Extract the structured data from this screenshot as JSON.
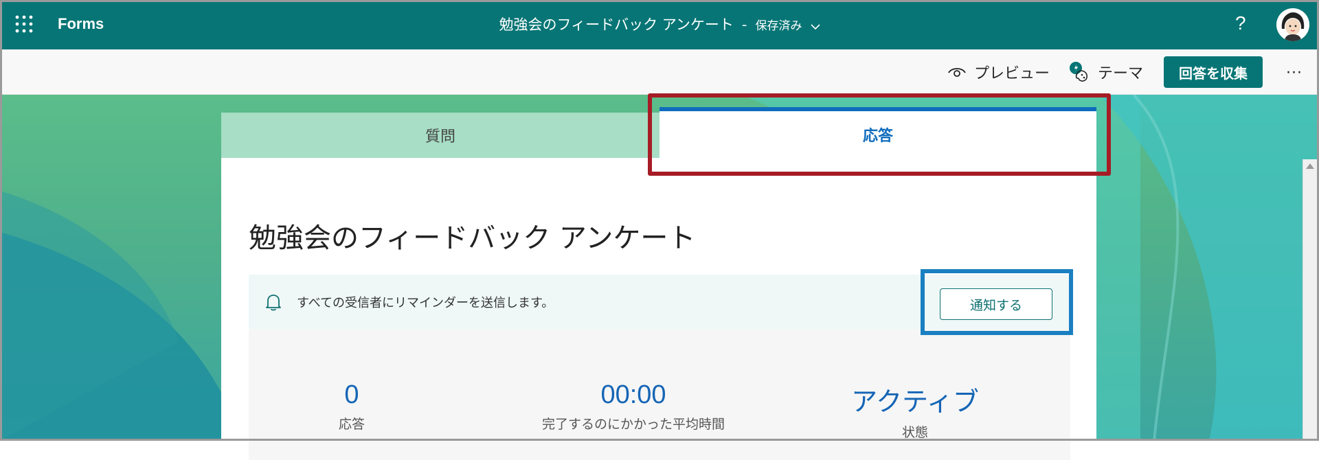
{
  "header": {
    "app_name": "Forms",
    "doc_title": "勉強会のフィードバック アンケート",
    "separator": "-",
    "save_status": "保存済み",
    "help_label": "?"
  },
  "commandbar": {
    "preview_label": "プレビュー",
    "theme_label": "テーマ",
    "collect_label": "回答を収集",
    "more_label": "···"
  },
  "tabs": [
    {
      "label": "質問",
      "active": false
    },
    {
      "label": "応答",
      "active": true
    }
  ],
  "form": {
    "title": "勉強会のフィードバック アンケート",
    "reminder_text": "すべての受信者にリマインダーを送信します。",
    "notify_label": "通知する"
  },
  "stats": [
    {
      "value": "0",
      "label": "応答"
    },
    {
      "value": "00:00",
      "label": "完了するのにかかった平均時間"
    },
    {
      "value": "アクティブ",
      "label": "状態"
    }
  ],
  "colors": {
    "header_bg": "#077575",
    "accent_blue": "#0f6cbd",
    "highlight_red": "#a61c26",
    "highlight_blue": "#1a7fc1"
  }
}
